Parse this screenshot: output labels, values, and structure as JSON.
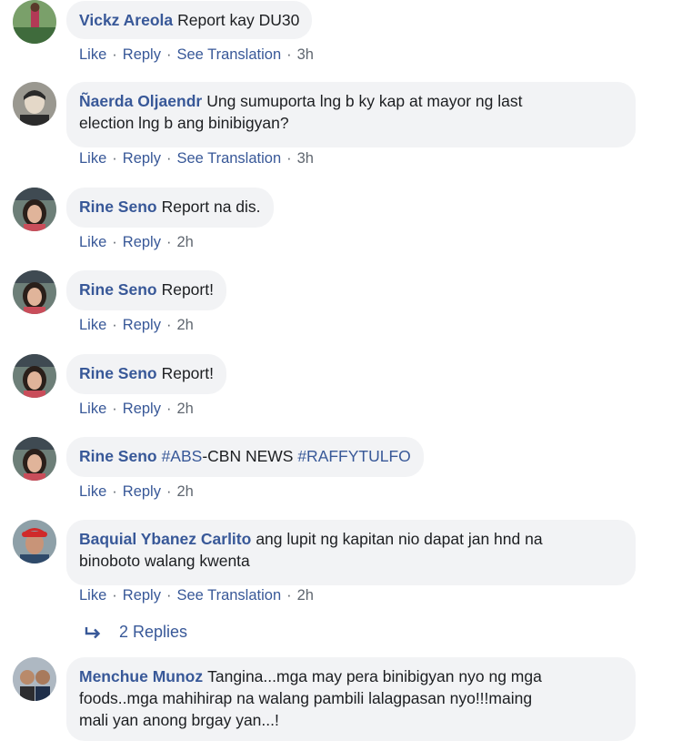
{
  "comments": [
    {
      "author": "Vickz Areola",
      "text": "Report kay DU30",
      "like": "Like",
      "reply": "Reply",
      "translate": "See Translation",
      "time": "3h"
    },
    {
      "author": "Ñaerda Oljaendr",
      "text_line1": "Ung sumuporta lng b ky kap at mayor ng last",
      "text_line2": "election lng b ang binibigyan?",
      "like": "Like",
      "reply": "Reply",
      "translate": "See Translation",
      "time": "3h"
    },
    {
      "author": "Rine Seno",
      "text": "Report na dis.",
      "like": "Like",
      "reply": "Reply",
      "time": "2h"
    },
    {
      "author": "Rine Seno",
      "text": "Report!",
      "like": "Like",
      "reply": "Reply",
      "time": "2h"
    },
    {
      "author": "Rine Seno",
      "text": "Report!",
      "like": "Like",
      "reply": "Reply",
      "time": "2h"
    },
    {
      "author": "Rine Seno",
      "tag1": "#ABS",
      "mid": "-CBN NEWS ",
      "tag2": "#RAFFYTULFO",
      "like": "Like",
      "reply": "Reply",
      "time": "2h"
    },
    {
      "author": "Baquial Ybanez Carlito",
      "text_line1": "ang lupit ng kapitan nio dapat jan hnd na",
      "text_line2": "binoboto walang kwenta",
      "like": "Like",
      "reply": "Reply",
      "translate": "See Translation",
      "time": "2h"
    },
    {
      "author": "Menchue Munoz",
      "text_line1": "Tangina...mga may pera binibigyan nyo ng mga",
      "text_line2": "foods..mga mahihirap na walang pambili lalagpasan nyo!!!maing",
      "text_line3": "mali yan anong brgay yan...!"
    }
  ],
  "replies_label": "2 Replies",
  "colors": {
    "link": "#385898",
    "bubble": "#f2f3f5",
    "meta": "#606770"
  },
  "icons": {
    "reply_arrow": "reply-arrow-icon"
  }
}
